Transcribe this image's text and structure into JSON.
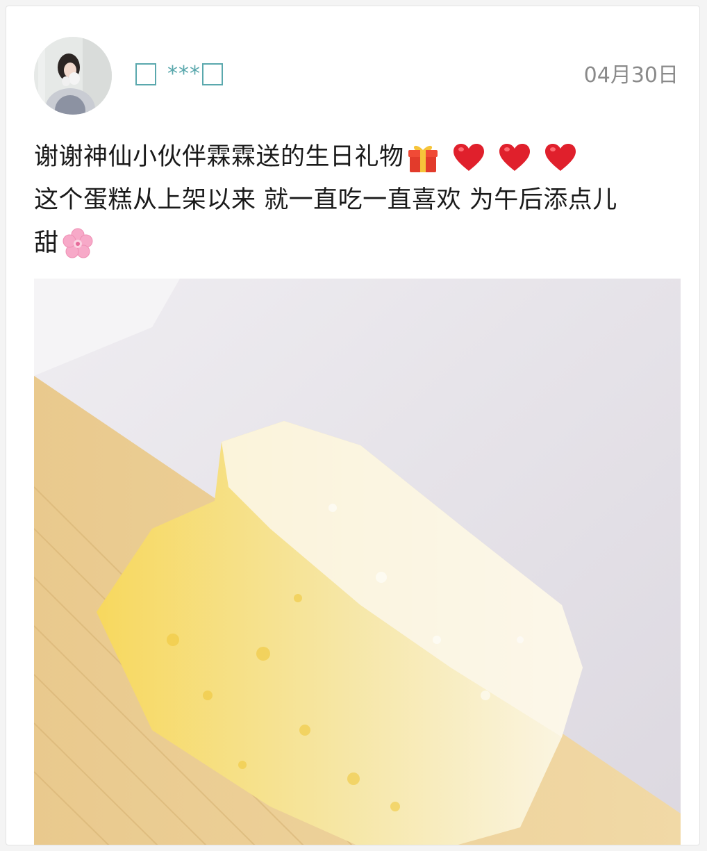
{
  "post": {
    "author": {
      "name_suffix": "***",
      "avatar_icon": "user-avatar"
    },
    "date": "04月30日",
    "lines": [
      "谢谢神仙小伙伴霖霖送的生日礼物",
      "这个蛋糕从上架以来 就一直吃一直喜欢 为午后添点儿",
      "甜"
    ],
    "emojis": {
      "line1": [
        "gift-icon",
        "heart-icon",
        "heart-icon",
        "heart-icon"
      ],
      "line3": [
        "cherry-blossom-icon"
      ]
    },
    "photo_icon": "cake-photo"
  },
  "colors": {
    "username": "#5aa8ad",
    "date": "#8a8a8a",
    "text": "#1a1a1a",
    "heart": "#e0202c",
    "blossom": "#f7a9c8"
  }
}
